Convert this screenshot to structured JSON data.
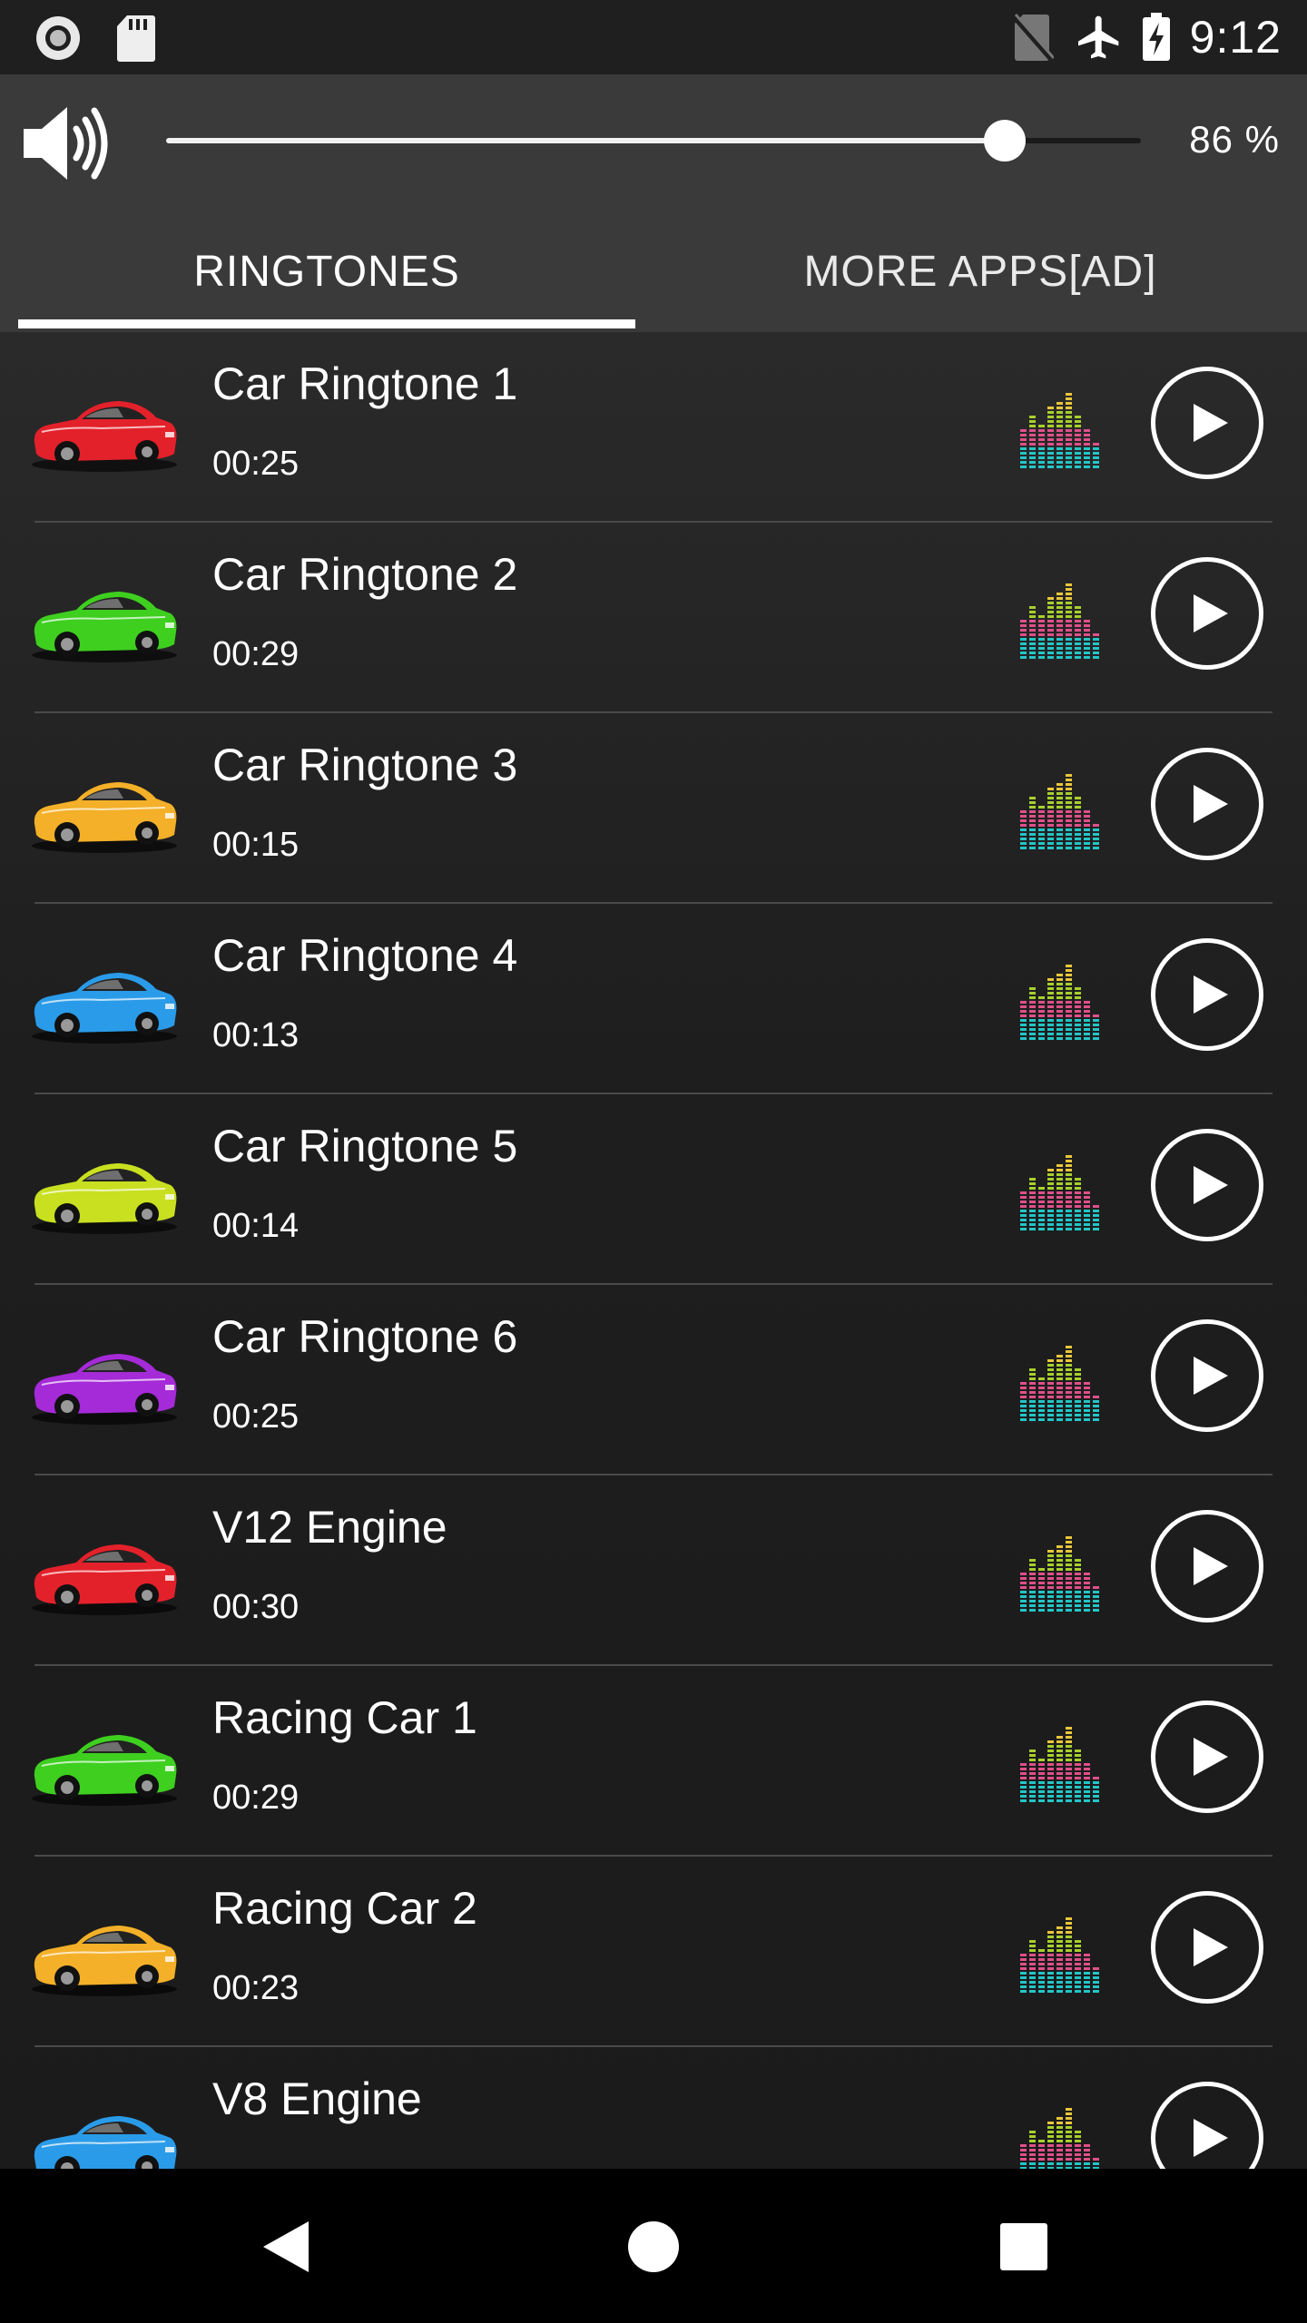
{
  "status_bar": {
    "time": "9:12",
    "left_icons": [
      "record-icon",
      "sd-card-icon"
    ],
    "right_icons": [
      "no-sim-icon",
      "airplane-icon",
      "battery-charging-icon"
    ]
  },
  "volume": {
    "percent_label": "86 %",
    "level": 0.86
  },
  "tabs": [
    {
      "label": "RINGTONES",
      "selected": true
    },
    {
      "label": "MORE APPS[AD]",
      "selected": false
    }
  ],
  "colors": {
    "red": "#e3212b",
    "green": "#3ecf1f",
    "orange": "#f3b028",
    "blue": "#2a9be8",
    "yellow": "#c8e020",
    "purple": "#a52ad8"
  },
  "ringtones": [
    {
      "title": "Car Ringtone 1",
      "duration": "00:25",
      "car_color": "#e3212b"
    },
    {
      "title": "Car Ringtone 2",
      "duration": "00:29",
      "car_color": "#3ecf1f"
    },
    {
      "title": "Car Ringtone 3",
      "duration": "00:15",
      "car_color": "#f3b028"
    },
    {
      "title": "Car Ringtone 4",
      "duration": "00:13",
      "car_color": "#2a9be8"
    },
    {
      "title": "Car Ringtone 5",
      "duration": "00:14",
      "car_color": "#c8e020"
    },
    {
      "title": "Car Ringtone 6",
      "duration": "00:25",
      "car_color": "#a52ad8"
    },
    {
      "title": "V12 Engine",
      "duration": "00:30",
      "car_color": "#e3212b"
    },
    {
      "title": "Racing Car 1",
      "duration": "00:29",
      "car_color": "#3ecf1f"
    },
    {
      "title": "Racing Car 2",
      "duration": "00:23",
      "car_color": "#f3b028"
    },
    {
      "title": "V8 Engine",
      "duration": "",
      "car_color": "#2a9be8"
    }
  ],
  "nav": [
    "back-icon",
    "home-icon",
    "recents-icon"
  ]
}
